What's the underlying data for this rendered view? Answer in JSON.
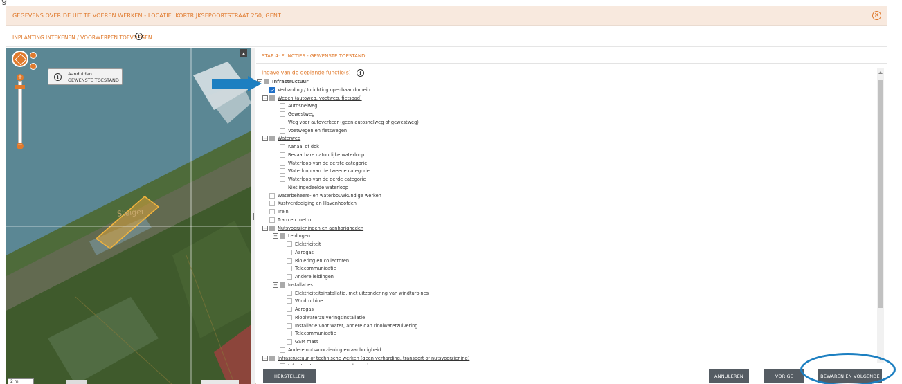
{
  "top_fragment": {
    "left": "g",
    "small": ""
  },
  "dialog": {
    "title": "GEGEVENS OVER DE UIT TE VOEREN WERKEN - LOCATIE: KORTRIJKSEPOORTSTRAAT 250, GENT",
    "close_icon": "close-circle-icon",
    "breadcrumb": "INPLANTING INTEKENEN / VOORWERPEN TOEVOEGEN",
    "accent_color": "#e07a2d"
  },
  "map": {
    "tooltip_line1": "Aanduiden",
    "tooltip_line2": "GEWENSTE TOESTAND",
    "feature_label": "Steiger",
    "scale": "2 m",
    "collapse_glyph": "▴",
    "zoom_plus": "+",
    "zoom_minus": "−"
  },
  "panel": {
    "step_title": "STAP 4: FUNCTIES - GEWENSTE TOESTAND",
    "functions_label": "Ingave van de geplande functie(s)",
    "tree": [
      {
        "label": "Infrastructuur",
        "level": 0,
        "expander": "⊟",
        "state": "partial",
        "style": "bold"
      },
      {
        "label": "Verharding / Inrichting openbaar domein",
        "level": 1,
        "expander": "",
        "state": "checked",
        "style": ""
      },
      {
        "label": "Wegen (autoweg, voetweg, fietspad)",
        "level": 1,
        "expander": "⊟",
        "state": "partial",
        "style": "ul"
      },
      {
        "label": "Autosnelweg",
        "level": 2,
        "expander": "",
        "state": "empty",
        "style": ""
      },
      {
        "label": "Gewestweg",
        "level": 2,
        "expander": "",
        "state": "empty",
        "style": ""
      },
      {
        "label": "Weg voor autoverkeer (geen autosnelweg of gewestweg)",
        "level": 2,
        "expander": "",
        "state": "empty",
        "style": ""
      },
      {
        "label": "Voetwegen en fietswegen",
        "level": 2,
        "expander": "",
        "state": "empty",
        "style": ""
      },
      {
        "label": "Waterweg",
        "level": 1,
        "expander": "⊟",
        "state": "partial",
        "style": "ul"
      },
      {
        "label": "Kanaal of dok",
        "level": 2,
        "expander": "",
        "state": "empty",
        "style": ""
      },
      {
        "label": "Bevaarbare natuurlijke waterloop",
        "level": 2,
        "expander": "",
        "state": "empty",
        "style": ""
      },
      {
        "label": "Waterloop van de eerste categorie",
        "level": 2,
        "expander": "",
        "state": "empty",
        "style": ""
      },
      {
        "label": "Waterloop van de tweede categorie",
        "level": 2,
        "expander": "",
        "state": "empty",
        "style": ""
      },
      {
        "label": "Waterloop van de derde categorie",
        "level": 2,
        "expander": "",
        "state": "empty",
        "style": ""
      },
      {
        "label": "Niet ingedeelde waterloop",
        "level": 2,
        "expander": "",
        "state": "empty",
        "style": ""
      },
      {
        "label": "Waterbeheers- en waterbouwkundige werken",
        "level": 1,
        "expander": "",
        "state": "empty",
        "style": ""
      },
      {
        "label": "Kustverdediging en Havenhoofden",
        "level": 1,
        "expander": "",
        "state": "empty",
        "style": ""
      },
      {
        "label": "Trein",
        "level": 1,
        "expander": "",
        "state": "empty",
        "style": ""
      },
      {
        "label": "Tram en metro",
        "level": 1,
        "expander": "",
        "state": "empty",
        "style": ""
      },
      {
        "label": "Nutsvoorzieningen en aanhorigheden",
        "level": 1,
        "expander": "⊟",
        "state": "partial",
        "style": "ul"
      },
      {
        "label": "Leidingen",
        "level": 2,
        "expander": "⊟",
        "state": "partial",
        "style": ""
      },
      {
        "label": "Elektriciteit",
        "level": 3,
        "expander": "",
        "state": "empty",
        "style": ""
      },
      {
        "label": "Aardgas",
        "level": 3,
        "expander": "",
        "state": "empty",
        "style": ""
      },
      {
        "label": "Riolering en collectoren",
        "level": 3,
        "expander": "",
        "state": "empty",
        "style": ""
      },
      {
        "label": "Telecommunicatie",
        "level": 3,
        "expander": "",
        "state": "empty",
        "style": ""
      },
      {
        "label": "Andere leidingen",
        "level": 3,
        "expander": "",
        "state": "empty",
        "style": ""
      },
      {
        "label": "Installaties",
        "level": 2,
        "expander": "⊟",
        "state": "partial",
        "style": ""
      },
      {
        "label": "Elektriciteitsinstallatie, met uitzondering van windturbines",
        "level": 3,
        "expander": "",
        "state": "empty",
        "style": ""
      },
      {
        "label": "Windturbine",
        "level": 3,
        "expander": "",
        "state": "empty",
        "style": ""
      },
      {
        "label": "Aardgas",
        "level": 3,
        "expander": "",
        "state": "empty",
        "style": ""
      },
      {
        "label": "Rioolwaterzuiveringsinstallatie",
        "level": 3,
        "expander": "",
        "state": "empty",
        "style": ""
      },
      {
        "label": "Installatie voor water, andere dan rioolwaterzuivering",
        "level": 3,
        "expander": "",
        "state": "empty",
        "style": ""
      },
      {
        "label": "Telecommunicatie",
        "level": 3,
        "expander": "",
        "state": "empty",
        "style": ""
      },
      {
        "label": "GSM mast",
        "level": 3,
        "expander": "",
        "state": "empty",
        "style": ""
      },
      {
        "label": "Andere nutsvoorziening en aanhorigheid",
        "level": 2,
        "expander": "",
        "state": "empty",
        "style": ""
      },
      {
        "label": "Infrastructuur of technische werken (geen verharding, transport of nutsvoorziening)",
        "level": 1,
        "expander": "⊟",
        "state": "partial",
        "style": "ul"
      },
      {
        "label": "Infrastructuur voor een kernbestatie",
        "level": 2,
        "expander": "",
        "state": "empty",
        "style": ""
      }
    ]
  },
  "footer": {
    "herstellen": "HERSTELLEN",
    "annuleren": "ANNULEREN",
    "vorige": "VORIGE",
    "bewaren": "BEWAREN EN VOLGENDE"
  },
  "colors": {
    "checkbox_checked": "#1e6fc7",
    "button": "#555c63",
    "annotation": "#1c7fc1"
  }
}
